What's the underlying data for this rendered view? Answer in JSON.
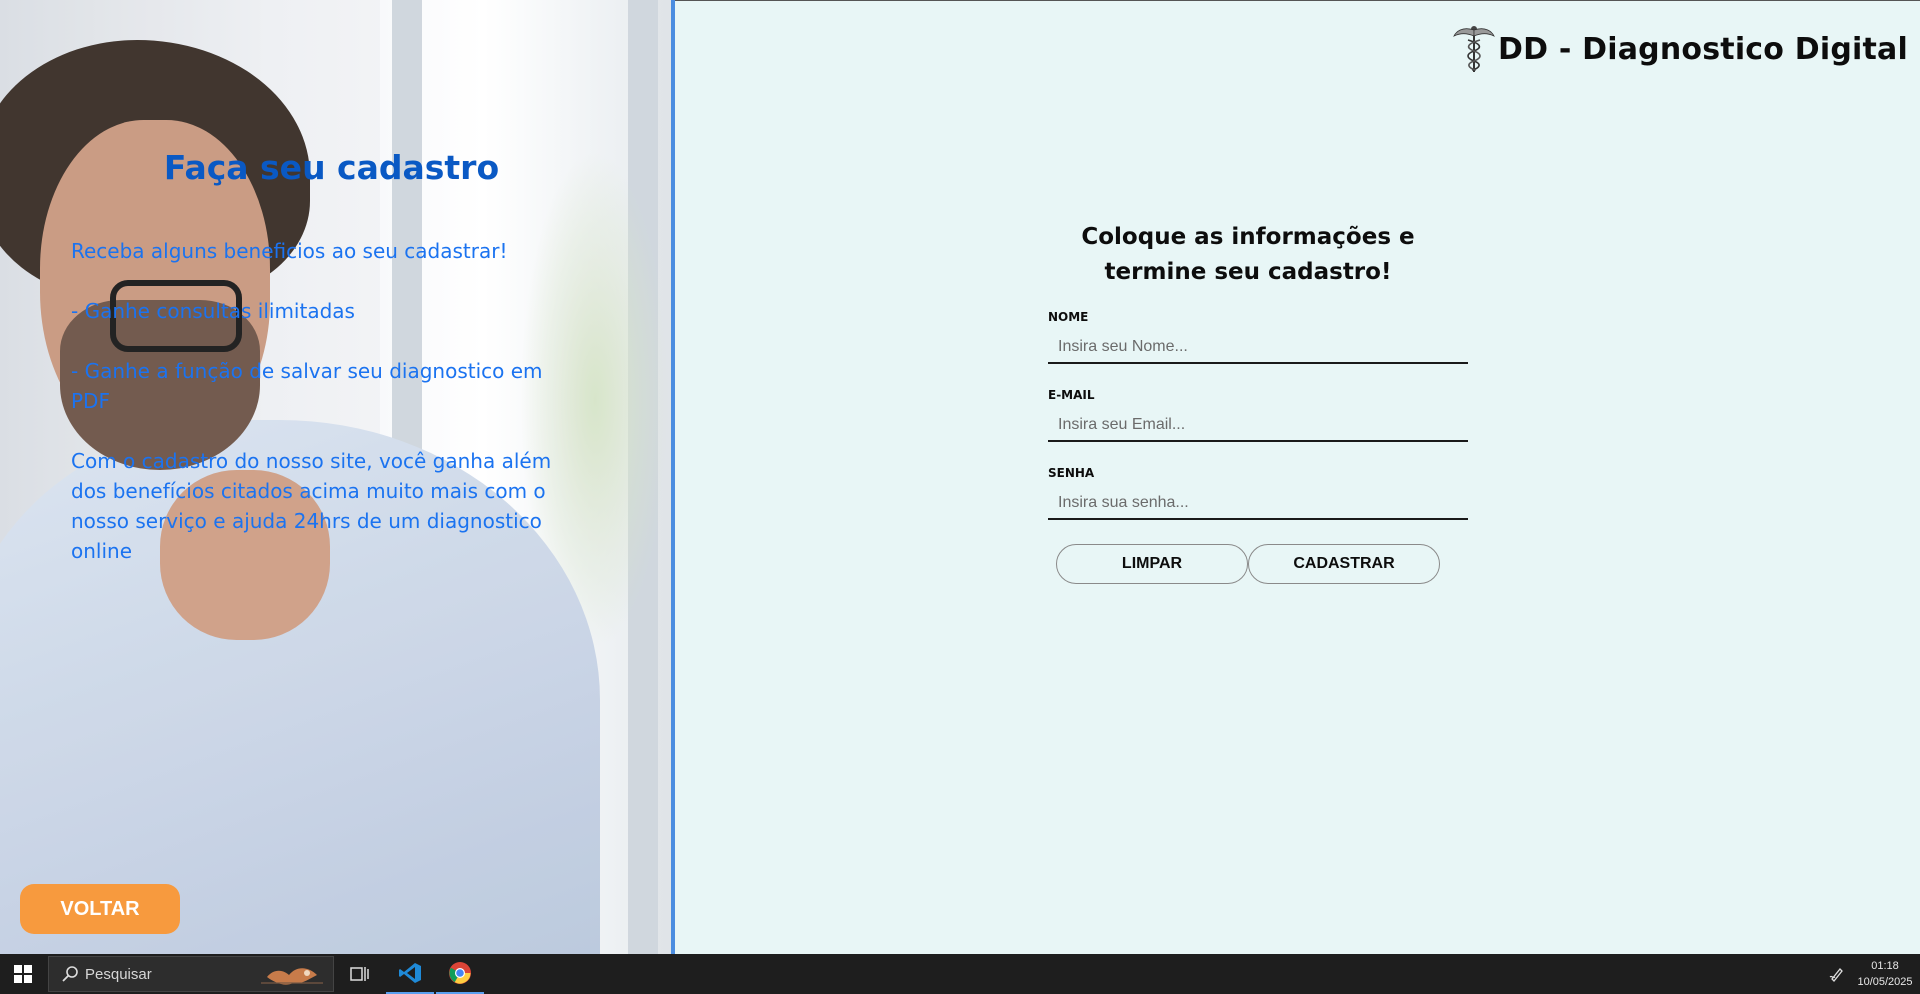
{
  "promo": {
    "title": "Faça seu cadastro",
    "paragraphs": [
      "Receba alguns beneficios ao seu cadastrar!",
      "- Ganhe consultas ilimitadas",
      "- Ganhe a função de salvar seu diagnostico em PDF",
      "Com o cadastro do nosso site, você ganha além dos benefícios citados acima muito mais com o nosso serviço e ajuda 24hrs de um diagnostico online"
    ],
    "back_label": "VOLTAR"
  },
  "brand": {
    "name": "DD - Diagnostico Digital",
    "logo_icon": "caduceus-icon"
  },
  "form": {
    "heading": "Coloque as informações e termine seu cadastro!",
    "fields": [
      {
        "label": "NOME",
        "placeholder": "Insira seu Nome...",
        "value": ""
      },
      {
        "label": "E-MAIL",
        "placeholder": "Insira seu Email...",
        "value": ""
      },
      {
        "label": "SENHA",
        "placeholder": "Insira sua senha...",
        "value": ""
      }
    ],
    "clear_label": "LIMPAR",
    "submit_label": "CADASTRAR"
  },
  "taskbar": {
    "search_placeholder": "Pesquisar",
    "time": "01:18",
    "date": "10/05/2025",
    "apps": [
      "task-view-icon",
      "vscode-icon",
      "chrome-icon"
    ]
  },
  "colors": {
    "accent_blue": "#1b73f0",
    "title_blue": "#0a59c4",
    "back_orange": "#f79a3e",
    "page_bg": "#e8f6f6"
  }
}
